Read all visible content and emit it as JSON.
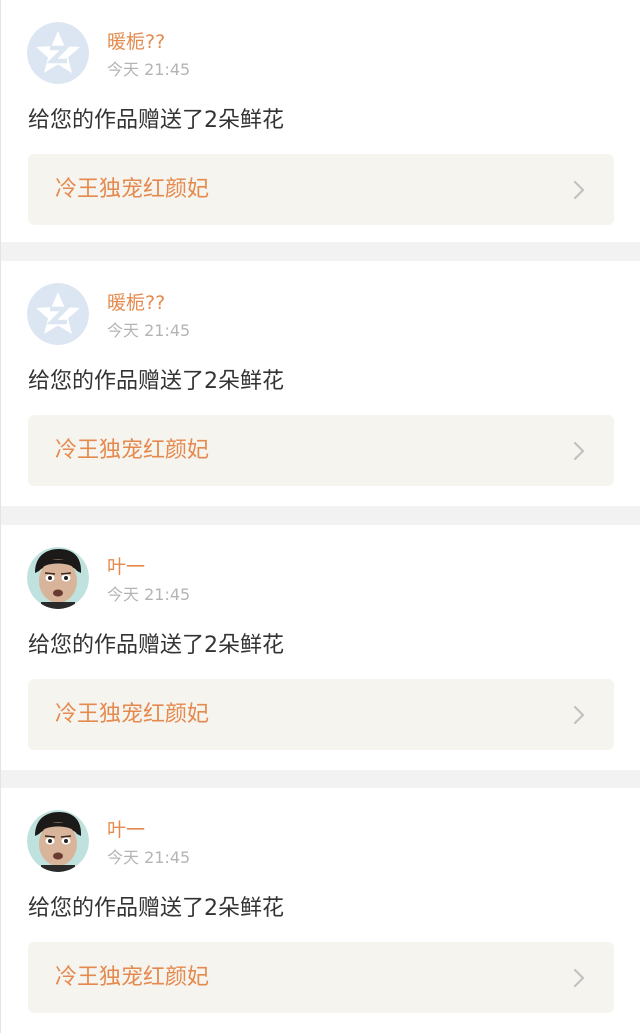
{
  "notifications": [
    {
      "username": "暖栀??",
      "time": "今天 21:45",
      "message": "给您的作品赠送了2朵鲜花",
      "work_title": "冷王独宠红颜妃",
      "avatar_icon": "default-avatar-icon",
      "chevron_icon": "chevron-right-icon"
    },
    {
      "username": "暖栀??",
      "time": "今天 21:45",
      "message": "给您的作品赠送了2朵鲜花",
      "work_title": "冷王独宠红颜妃",
      "avatar_icon": "default-avatar-icon",
      "chevron_icon": "chevron-right-icon"
    },
    {
      "username": "叶一",
      "time": "今天 21:45",
      "message": "给您的作品赠送了2朵鲜花",
      "work_title": "冷王独宠红颜妃",
      "avatar_icon": "user-photo-avatar",
      "chevron_icon": "chevron-right-icon"
    },
    {
      "username": "叶一",
      "time": "今天 21:45",
      "message": "给您的作品赠送了2朵鲜花",
      "work_title": "冷王独宠红颜妃",
      "avatar_icon": "user-photo-avatar",
      "chevron_icon": "chevron-right-icon"
    }
  ],
  "colors": {
    "accent": "#e58a4e",
    "background": "#f2f2f2",
    "card": "#ffffff",
    "link_box": "#f6f4ef",
    "message_text": "#333333",
    "time_text": "#b4b4b4"
  }
}
